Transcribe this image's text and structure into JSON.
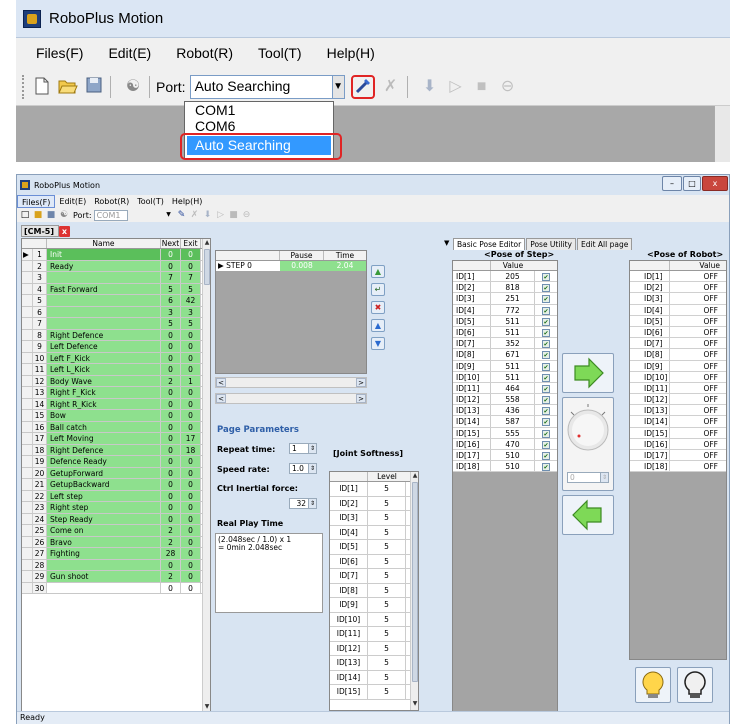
{
  "top": {
    "title": "RoboPlus Motion",
    "menus": [
      "Files(F)",
      "Edit(E)",
      "Robot(R)",
      "Tool(T)",
      "Help(H)"
    ],
    "port_label": "Port:",
    "port_value": "Auto Searching",
    "port_options": [
      "COM1",
      "COM6",
      "Auto Searching"
    ]
  },
  "window": {
    "title": "RoboPlus Motion",
    "menus": [
      "Files(F)",
      "Edit(E)",
      "Robot(R)",
      "Tool(T)",
      "Help(H)"
    ],
    "port_label": "Port:",
    "port_value": "COM1",
    "doc_tab": "[CM-5]",
    "status": "Ready"
  },
  "page_table": {
    "headers": [
      "Name",
      "Next",
      "Exit"
    ],
    "rows": [
      {
        "n": "1",
        "name": "Init",
        "next": "0",
        "exit": "0"
      },
      {
        "n": "2",
        "name": "Ready",
        "next": "0",
        "exit": "0"
      },
      {
        "n": "3",
        "name": "",
        "next": "7",
        "exit": "7"
      },
      {
        "n": "4",
        "name": "Fast Forward",
        "next": "5",
        "exit": "5"
      },
      {
        "n": "5",
        "name": "",
        "next": "6",
        "exit": "42"
      },
      {
        "n": "6",
        "name": "",
        "next": "3",
        "exit": "3"
      },
      {
        "n": "7",
        "name": "",
        "next": "5",
        "exit": "5"
      },
      {
        "n": "8",
        "name": "Right Defence",
        "next": "0",
        "exit": "0"
      },
      {
        "n": "9",
        "name": "Left Defence",
        "next": "0",
        "exit": "0"
      },
      {
        "n": "10",
        "name": "Left F_Kick",
        "next": "0",
        "exit": "0"
      },
      {
        "n": "11",
        "name": "Left L_Kick",
        "next": "0",
        "exit": "0"
      },
      {
        "n": "12",
        "name": "Body Wave",
        "next": "2",
        "exit": "1"
      },
      {
        "n": "13",
        "name": "Right F_Kick",
        "next": "0",
        "exit": "0"
      },
      {
        "n": "14",
        "name": "Right R_Kick",
        "next": "0",
        "exit": "0"
      },
      {
        "n": "15",
        "name": "Bow",
        "next": "0",
        "exit": "0"
      },
      {
        "n": "16",
        "name": "Ball catch",
        "next": "0",
        "exit": "0"
      },
      {
        "n": "17",
        "name": "Left Moving",
        "next": "0",
        "exit": "17"
      },
      {
        "n": "18",
        "name": "Right Defence",
        "next": "0",
        "exit": "18"
      },
      {
        "n": "19",
        "name": "Defence Ready",
        "next": "0",
        "exit": "0"
      },
      {
        "n": "20",
        "name": "GetupForward",
        "next": "0",
        "exit": "0"
      },
      {
        "n": "21",
        "name": "GetupBackward",
        "next": "0",
        "exit": "0"
      },
      {
        "n": "22",
        "name": "Left step",
        "next": "0",
        "exit": "0"
      },
      {
        "n": "23",
        "name": "Right step",
        "next": "0",
        "exit": "0"
      },
      {
        "n": "24",
        "name": "Step Ready",
        "next": "0",
        "exit": "0"
      },
      {
        "n": "25",
        "name": "Come on",
        "next": "2",
        "exit": "0"
      },
      {
        "n": "26",
        "name": "Bravo",
        "next": "2",
        "exit": "0"
      },
      {
        "n": "27",
        "name": "Fighting",
        "next": "28",
        "exit": "0"
      },
      {
        "n": "28",
        "name": "",
        "next": "0",
        "exit": "0"
      },
      {
        "n": "29",
        "name": "Gun shoot",
        "next": "2",
        "exit": "0"
      },
      {
        "n": "30",
        "name": "",
        "next": "0",
        "exit": "0"
      }
    ]
  },
  "steps": {
    "headers": [
      "",
      "Pause",
      "Time"
    ],
    "rows": [
      {
        "name": "STEP 0",
        "pause": "0.008",
        "time": "2.04"
      }
    ]
  },
  "params": {
    "title": "Page Parameters",
    "repeat_label": "Repeat time:",
    "repeat_value": "1",
    "speed_label": "Speed rate:",
    "speed_value": "1.0",
    "inertial_label": "Ctrl Inertial force:",
    "inertial_value": "32",
    "real_play_label": "Real Play Time",
    "real_play_text_1": "(2.048sec / 1.0) x 1",
    "real_play_text_2": "= 0min 2.048sec"
  },
  "joint": {
    "title": "[Joint Softness]",
    "header": "Level",
    "rows": [
      {
        "id": "ID[1]",
        "v": "5"
      },
      {
        "id": "ID[2]",
        "v": "5"
      },
      {
        "id": "ID[3]",
        "v": "5"
      },
      {
        "id": "ID[4]",
        "v": "5"
      },
      {
        "id": "ID[5]",
        "v": "5"
      },
      {
        "id": "ID[6]",
        "v": "5"
      },
      {
        "id": "ID[7]",
        "v": "5"
      },
      {
        "id": "ID[8]",
        "v": "5"
      },
      {
        "id": "ID[9]",
        "v": "5"
      },
      {
        "id": "ID[10]",
        "v": "5"
      },
      {
        "id": "ID[11]",
        "v": "5"
      },
      {
        "id": "ID[12]",
        "v": "5"
      },
      {
        "id": "ID[13]",
        "v": "5"
      },
      {
        "id": "ID[14]",
        "v": "5"
      },
      {
        "id": "ID[15]",
        "v": "5"
      }
    ]
  },
  "right_tabs": [
    "Basic Pose Editor",
    "Pose Utility",
    "Edit All page"
  ],
  "pose_step": {
    "title": "<Pose of Step>",
    "header": "Value",
    "rows": [
      {
        "id": "ID[1]",
        "v": "205"
      },
      {
        "id": "ID[2]",
        "v": "818"
      },
      {
        "id": "ID[3]",
        "v": "251"
      },
      {
        "id": "ID[4]",
        "v": "772"
      },
      {
        "id": "ID[5]",
        "v": "511"
      },
      {
        "id": "ID[6]",
        "v": "511"
      },
      {
        "id": "ID[7]",
        "v": "352"
      },
      {
        "id": "ID[8]",
        "v": "671"
      },
      {
        "id": "ID[9]",
        "v": "511"
      },
      {
        "id": "ID[10]",
        "v": "511"
      },
      {
        "id": "ID[11]",
        "v": "464"
      },
      {
        "id": "ID[12]",
        "v": "558"
      },
      {
        "id": "ID[13]",
        "v": "436"
      },
      {
        "id": "ID[14]",
        "v": "587"
      },
      {
        "id": "ID[15]",
        "v": "555"
      },
      {
        "id": "ID[16]",
        "v": "470"
      },
      {
        "id": "ID[17]",
        "v": "510"
      },
      {
        "id": "ID[18]",
        "v": "510"
      }
    ]
  },
  "pose_robot": {
    "title": "<Pose of Robot>",
    "header": "Value",
    "rows": [
      {
        "id": "ID[1]",
        "v": "OFF"
      },
      {
        "id": "ID[2]",
        "v": "OFF"
      },
      {
        "id": "ID[3]",
        "v": "OFF"
      },
      {
        "id": "ID[4]",
        "v": "OFF"
      },
      {
        "id": "ID[5]",
        "v": "OFF"
      },
      {
        "id": "ID[6]",
        "v": "OFF"
      },
      {
        "id": "ID[7]",
        "v": "OFF"
      },
      {
        "id": "ID[8]",
        "v": "OFF"
      },
      {
        "id": "ID[9]",
        "v": "OFF"
      },
      {
        "id": "ID[10]",
        "v": "OFF"
      },
      {
        "id": "ID[11]",
        "v": "OFF"
      },
      {
        "id": "ID[12]",
        "v": "OFF"
      },
      {
        "id": "ID[13]",
        "v": "OFF"
      },
      {
        "id": "ID[14]",
        "v": "OFF"
      },
      {
        "id": "ID[15]",
        "v": "OFF"
      },
      {
        "id": "ID[16]",
        "v": "OFF"
      },
      {
        "id": "ID[17]",
        "v": "OFF"
      },
      {
        "id": "ID[18]",
        "v": "OFF"
      }
    ]
  },
  "dial_value": "0",
  "colors": {
    "highlight_red": "#e02424",
    "row_green": "#8ee08e",
    "selection_blue": "#3399ff"
  },
  "icons": [
    "new-icon",
    "open-icon",
    "save-icon",
    "connect-icon",
    "wrench-icon",
    "disconnect-icon",
    "download-icon",
    "play-icon",
    "stop-icon",
    "record-icon"
  ]
}
